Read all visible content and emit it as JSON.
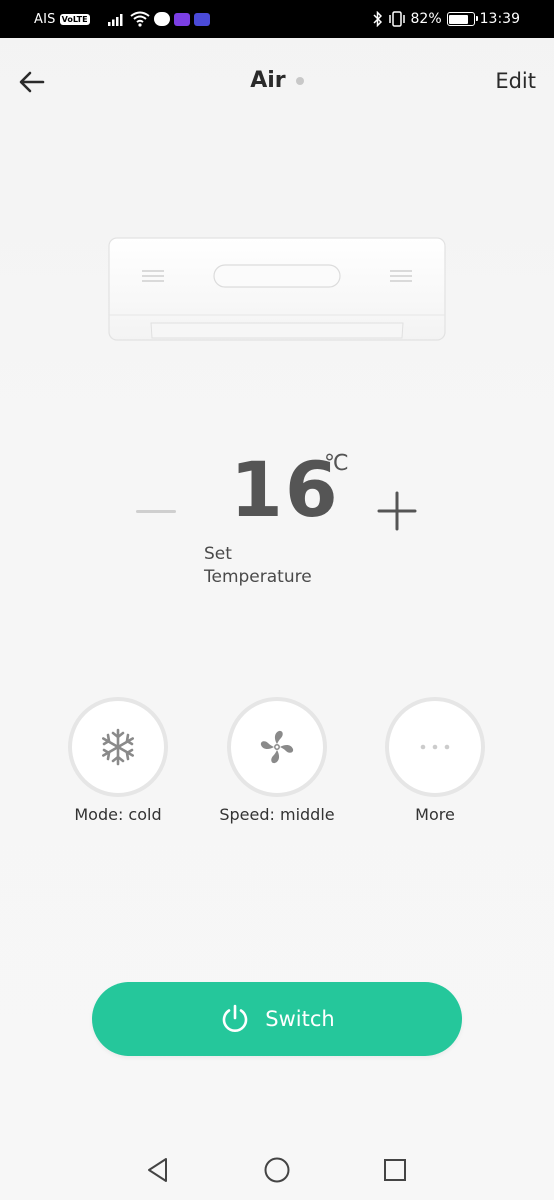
{
  "status_bar": {
    "carrier": "AIS",
    "network_badge": "VoLTE",
    "battery": "82%",
    "battery_level": 0.82,
    "time": "13:39",
    "icons": [
      "signal-icon",
      "wifi-icon",
      "line-icon",
      "app-badge-icon",
      "bluetooth-icon",
      "vibrate-icon",
      "battery-icon"
    ]
  },
  "header": {
    "back_icon": "arrow-left-icon",
    "title": "Air",
    "edit_label": "Edit"
  },
  "temperature": {
    "value": "16",
    "unit": "℃",
    "label_line1": "Set",
    "label_line2": "Temperature"
  },
  "controls": [
    {
      "label": "Mode: cold",
      "icon": "snowflake-icon"
    },
    {
      "label": "Speed: middle",
      "icon": "fan-icon"
    },
    {
      "label": "More",
      "icon": "more-dots-icon"
    }
  ],
  "switch": {
    "label": "Switch",
    "icon": "power-icon"
  },
  "colors": {
    "accent": "#25c79b",
    "text": "#2b2b2b",
    "temperature": "#555555",
    "background": "#f5f5f5"
  },
  "nav_bar": {
    "icons": [
      "back-triangle-icon",
      "home-circle-icon",
      "recents-square-icon"
    ]
  }
}
